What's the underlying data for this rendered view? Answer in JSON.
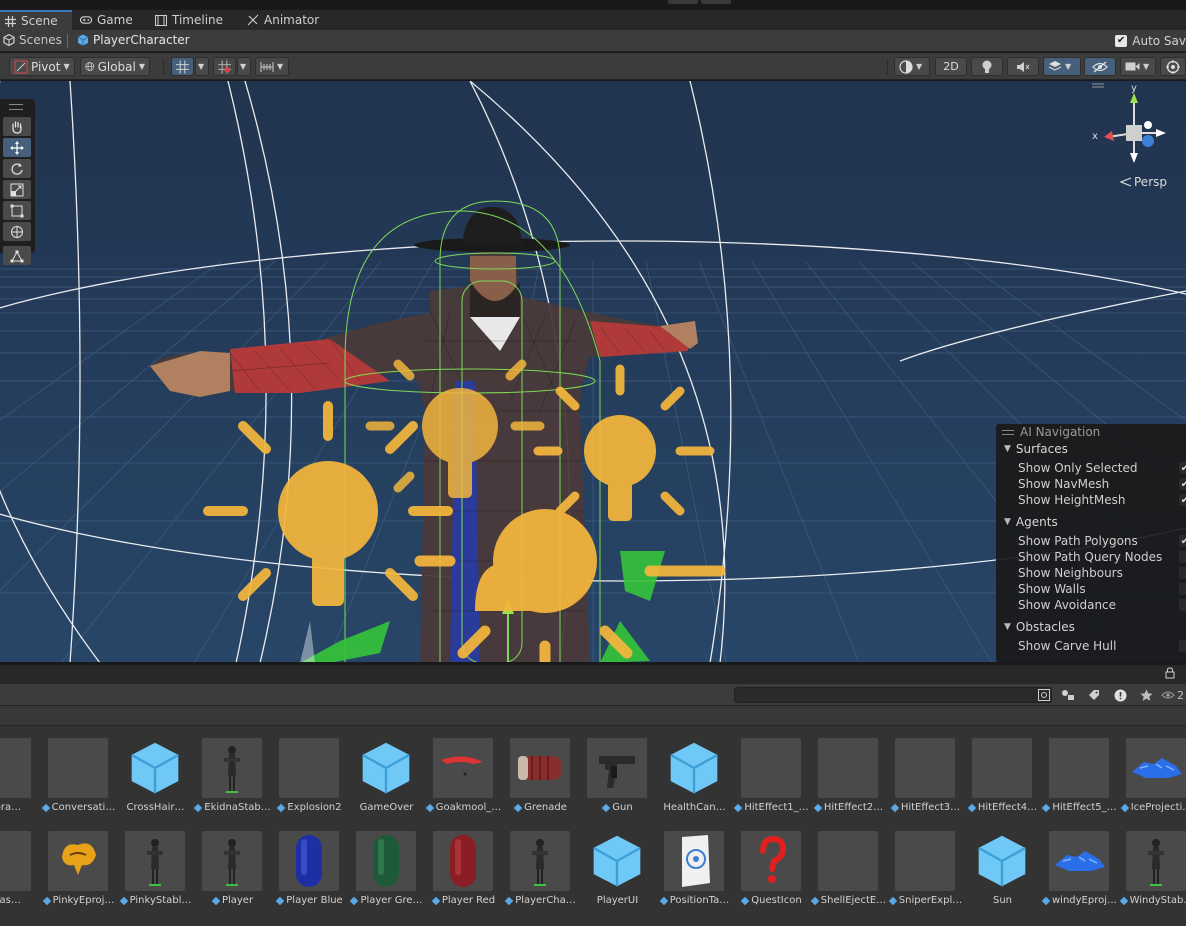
{
  "tabs": [
    {
      "label": "Scene",
      "icon": "grid-icon",
      "active": true
    },
    {
      "label": "Game",
      "icon": "gamepad-icon",
      "active": false
    },
    {
      "label": "Timeline",
      "icon": "timeline-icon",
      "active": false
    },
    {
      "label": "Animator",
      "icon": "animator-icon",
      "active": false
    }
  ],
  "breadcrumb": {
    "scenes_label": "Scenes",
    "current": "PlayerCharacter",
    "autosave_label": "Auto Sav",
    "autosave_checked": true
  },
  "scene_toolbar": {
    "pivot_label": "Pivot",
    "global_label": "Global",
    "mode_2d_label": "2D"
  },
  "viewport": {
    "persp_label": "Persp",
    "gizmo_axes": {
      "x": "x",
      "y": "y"
    }
  },
  "ai_navigation": {
    "title": "AI Navigation",
    "sections": [
      {
        "label": "Surfaces",
        "options": [
          {
            "label": "Show Only Selected",
            "checked": true
          },
          {
            "label": "Show NavMesh",
            "checked": true
          },
          {
            "label": "Show HeightMesh",
            "checked": true
          }
        ]
      },
      {
        "label": "Agents",
        "options": [
          {
            "label": "Show Path Polygons",
            "checked": true
          },
          {
            "label": "Show Path Query Nodes",
            "checked": false
          },
          {
            "label": "Show Neighbours",
            "checked": false
          },
          {
            "label": "Show Walls",
            "checked": false
          },
          {
            "label": "Show Avoidance",
            "checked": false
          }
        ]
      },
      {
        "label": "Obstacles",
        "options": [
          {
            "label": "Show Carve Hull",
            "checked": false
          }
        ]
      }
    ]
  },
  "project": {
    "search_placeholder": "",
    "hidden_count": "2",
    "assets_row1": [
      {
        "label": "dSpra…",
        "prefab": false,
        "thumb": "gray"
      },
      {
        "label": "Conversati…",
        "prefab": true,
        "thumb": "gray"
      },
      {
        "label": "CrossHair…",
        "prefab": false,
        "thumb": "cube"
      },
      {
        "label": "EkidnaStab…",
        "prefab": true,
        "thumb": "figure"
      },
      {
        "label": "Explosion2",
        "prefab": true,
        "thumb": "gray"
      },
      {
        "label": "GameOver",
        "prefab": false,
        "thumb": "cube"
      },
      {
        "label": "Goakmool_…",
        "prefab": true,
        "thumb": "goak"
      },
      {
        "label": "Grenade",
        "prefab": true,
        "thumb": "grenade"
      },
      {
        "label": "Gun",
        "prefab": true,
        "thumb": "gun"
      },
      {
        "label": "HealthCan…",
        "prefab": false,
        "thumb": "cube"
      },
      {
        "label": "HitEffect1_…",
        "prefab": true,
        "thumb": "gray"
      },
      {
        "label": "HitEffect2…",
        "prefab": true,
        "thumb": "gray"
      },
      {
        "label": "HitEffect3…",
        "prefab": true,
        "thumb": "gray"
      },
      {
        "label": "HitEffect4…",
        "prefab": true,
        "thumb": "gray"
      },
      {
        "label": "HitEffect5_…",
        "prefab": true,
        "thumb": "gray"
      },
      {
        "label": "IceProjecti…",
        "prefab": true,
        "thumb": "ice"
      }
    ],
    "assets_row2": [
      {
        "label": "leFlas…",
        "prefab": false,
        "thumb": "gray"
      },
      {
        "label": "PinkyEproj…",
        "prefab": true,
        "thumb": "pinky"
      },
      {
        "label": "PinkyStabl…",
        "prefab": true,
        "thumb": "figure"
      },
      {
        "label": "Player",
        "prefab": true,
        "thumb": "figure"
      },
      {
        "label": "Player Blue",
        "prefab": true,
        "thumb": "capblue"
      },
      {
        "label": "Player Gre…",
        "prefab": true,
        "thumb": "capgreen"
      },
      {
        "label": "Player Red",
        "prefab": true,
        "thumb": "capred"
      },
      {
        "label": "PlayerCha…",
        "prefab": true,
        "thumb": "figure"
      },
      {
        "label": "PlayerUI",
        "prefab": false,
        "thumb": "cube"
      },
      {
        "label": "PositionTa…",
        "prefab": true,
        "thumb": "target"
      },
      {
        "label": "QuestIcon",
        "prefab": true,
        "thumb": "quest"
      },
      {
        "label": "ShellEjectE…",
        "prefab": true,
        "thumb": "gray"
      },
      {
        "label": "SniperExpl…",
        "prefab": true,
        "thumb": "gray"
      },
      {
        "label": "Sun",
        "prefab": false,
        "thumb": "cube"
      },
      {
        "label": "windyEproj…",
        "prefab": true,
        "thumb": "ice"
      },
      {
        "label": "WindyStab…",
        "prefab": true,
        "thumb": "figure"
      }
    ]
  },
  "colors": {
    "accent": "#3a79bb",
    "light_icon": "#f6b73c",
    "navmesh_wire": "#7ed957",
    "cube_icon": "#6fc8f5"
  }
}
